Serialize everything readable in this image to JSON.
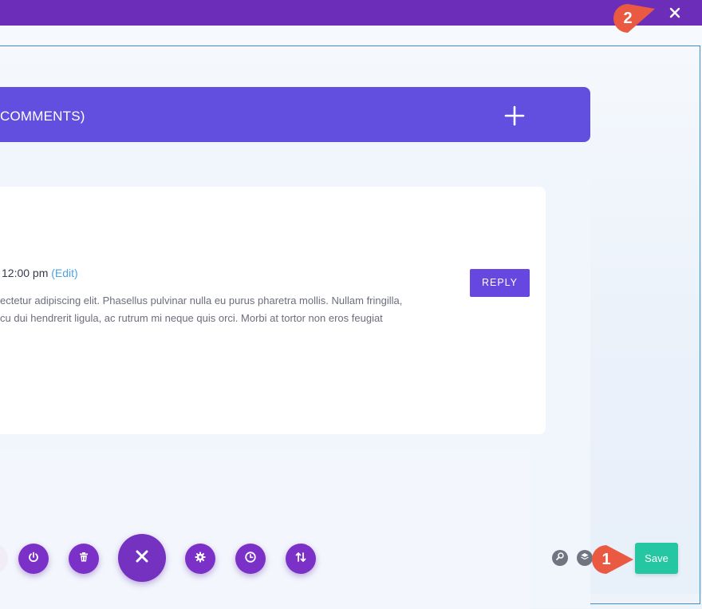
{
  "topbar": {
    "close_icon": "close-icon",
    "color": "#6c2eb9"
  },
  "accordion": {
    "title": "COMMENTS)",
    "toggle_icon": "plus-icon",
    "header_color": "#624fe0"
  },
  "comment": {
    "time": "12:00 pm",
    "edit_label": "(Edit)",
    "text": "ectetur adipiscing elit. Phasellus pulvinar nulla eu purus pharetra mollis. Nullam fringilla,\ncu dui hendrerit ligula, ac rutrum mi neque quis orci. Morbi at tortor non eros feugiat",
    "reply_label": "REPLY",
    "reply_color": "#6648e0"
  },
  "toolbar": {
    "buttons": [
      {
        "icon": "power-icon"
      },
      {
        "icon": "trash-icon"
      },
      {
        "icon": "close-icon"
      },
      {
        "icon": "gear-icon"
      },
      {
        "icon": "clock-icon"
      },
      {
        "icon": "sort-arrows-icon"
      }
    ],
    "button_color": "#7b31c7"
  },
  "page_actions": {
    "zoom_icon": "search-icon",
    "layers_icon": "layers-icon",
    "save_label": "Save",
    "save_color": "#25c7a2"
  },
  "callouts": [
    {
      "number": "1",
      "color": "#ea5a42"
    },
    {
      "number": "2",
      "color": "#ea5a42"
    }
  ]
}
